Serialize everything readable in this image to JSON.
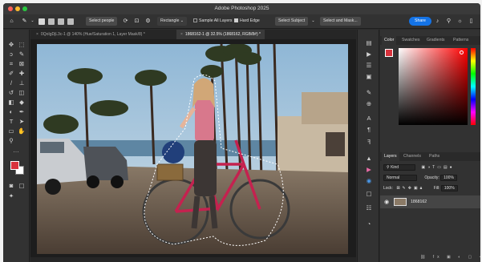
{
  "app": {
    "title": "Adobe Photoshop 2025"
  },
  "window": {
    "traffic_colors": [
      "#ff5f57",
      "#febc2e",
      "#28c840"
    ]
  },
  "options_bar": {
    "select_people": "Select people",
    "mode": "Rectangle",
    "sample_all_layers": "Sample All Layers",
    "hard_edge": "Hard Edge",
    "select_subject": "Select Subject",
    "select_and_mask": "Select and Mask...",
    "share": "Share",
    "accent_color": "#1473e6"
  },
  "document_tabs": [
    {
      "label": "0QoIgDjL3c-1 @ 140% (Hue/Saturation 1, Layer Mask/8) *",
      "active": false
    },
    {
      "label": "1868162-1 @ 32.5% (1868162, RGB/8#) *",
      "active": true
    }
  ],
  "colors": {
    "foreground": "#d8323c",
    "background": "#ffffff"
  },
  "color_panel": {
    "tabs": [
      "Color",
      "Swatches",
      "Gradients",
      "Patterns"
    ],
    "active": "Color"
  },
  "layers_panel": {
    "tabs": [
      "Layers",
      "Channels",
      "Paths"
    ],
    "active": "Layers",
    "filter": "Kind",
    "blend_mode": "Normal",
    "opacity_label": "Opacity:",
    "opacity": "100%",
    "lock_label": "Lock:",
    "fill_label": "Fill:",
    "fill": "100%",
    "layers": [
      {
        "name": "1868162",
        "visible": true
      }
    ]
  },
  "icons": {
    "home": "⌂",
    "move": "✥",
    "marquee": "⬚",
    "lasso": "ↄ",
    "quick_select": "✎",
    "crop": "⌗",
    "frame": "⊠",
    "eyedropper": "✐",
    "heal": "✚",
    "brush": "/",
    "stamp": "⊥",
    "history": "↺",
    "eraser": "◫",
    "gradient": "◧",
    "blur": "◆",
    "dodge": "◐",
    "pen": "✒",
    "type": "T",
    "path_select": "➤",
    "shape": "▭",
    "hand": "✋",
    "zoom": "⚲",
    "more": "…",
    "search": "⚲",
    "bell": "♪",
    "lightbulb": "☼",
    "gear": "⚙",
    "eye": "◉",
    "chevron": "›"
  }
}
